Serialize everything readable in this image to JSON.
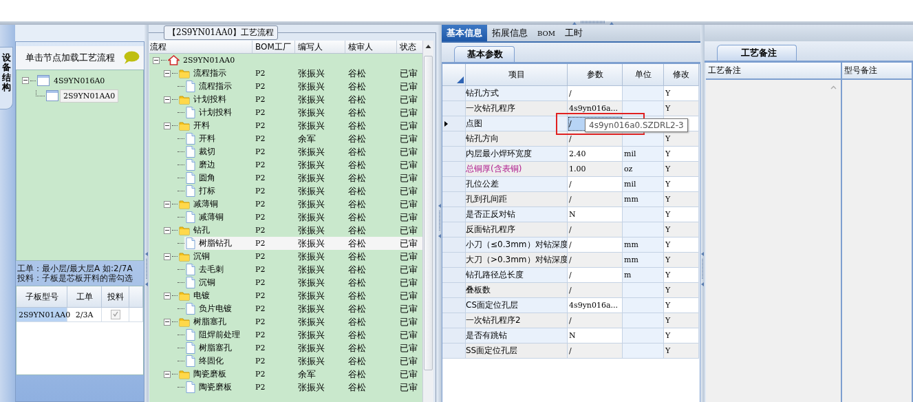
{
  "left_panel": {
    "vertical_tab": "设备结构",
    "hint": "单击节点加载工艺流程",
    "tree": [
      {
        "label": "4S9YN016A0",
        "expanded": true,
        "selected": false,
        "children": [
          {
            "label": "2S9YN01AA0",
            "selected": true
          }
        ]
      }
    ],
    "notes": [
      "工单：最小层/最大层A 如:2/7A",
      "投料：子板是芯板开料的需勾选"
    ],
    "board_table": {
      "columns": [
        "子板型号",
        "工单",
        "投料"
      ],
      "rows": [
        {
          "model": "2S9YN01AA0",
          "work_order": "2/3A",
          "feed": true,
          "selected": true
        }
      ]
    }
  },
  "flow_panel": {
    "title": "【2S9YN01AA0】工艺流程",
    "columns": [
      "流程",
      "BOM工厂",
      "编写人",
      "核审人",
      "状态"
    ],
    "tree": [
      {
        "kind": "root",
        "label": "2S9YN01AA0",
        "expanded": true,
        "selected": false,
        "children": [
          {
            "kind": "folder",
            "label": "流程指示",
            "factory": "P2",
            "writer": "张振兴",
            "reviewer": "谷松",
            "status": "已审",
            "expanded": true,
            "selected": false,
            "children": [
              {
                "kind": "file",
                "label": "流程指示",
                "factory": "P2",
                "writer": "张振兴",
                "reviewer": "谷松",
                "status": "已审",
                "selected": false
              }
            ]
          },
          {
            "kind": "folder",
            "label": "计划投料",
            "factory": "P2",
            "writer": "张振兴",
            "reviewer": "谷松",
            "status": "已审",
            "expanded": true,
            "selected": false,
            "children": [
              {
                "kind": "file",
                "label": "计划投料",
                "factory": "P2",
                "writer": "张振兴",
                "reviewer": "谷松",
                "status": "已审",
                "selected": false
              }
            ]
          },
          {
            "kind": "folder",
            "label": "开料",
            "factory": "P2",
            "writer": "张振兴",
            "reviewer": "谷松",
            "status": "已审",
            "expanded": true,
            "selected": false,
            "children": [
              {
                "kind": "file",
                "label": "开料",
                "factory": "P2",
                "writer": "余军",
                "reviewer": "谷松",
                "status": "已审",
                "selected": false
              },
              {
                "kind": "file",
                "label": "裁切",
                "factory": "P2",
                "writer": "张振兴",
                "reviewer": "谷松",
                "status": "已审",
                "selected": false
              },
              {
                "kind": "file",
                "label": "磨边",
                "factory": "P2",
                "writer": "张振兴",
                "reviewer": "谷松",
                "status": "已审",
                "selected": false
              },
              {
                "kind": "file",
                "label": "圆角",
                "factory": "P2",
                "writer": "张振兴",
                "reviewer": "谷松",
                "status": "已审",
                "selected": false
              },
              {
                "kind": "file",
                "label": "打标",
                "factory": "P2",
                "writer": "张振兴",
                "reviewer": "谷松",
                "status": "已审",
                "selected": false
              }
            ]
          },
          {
            "kind": "folder",
            "label": "减薄铜",
            "factory": "P2",
            "writer": "张振兴",
            "reviewer": "谷松",
            "status": "已审",
            "expanded": true,
            "selected": false,
            "children": [
              {
                "kind": "file",
                "label": "减薄铜",
                "factory": "P2",
                "writer": "张振兴",
                "reviewer": "谷松",
                "status": "已审",
                "selected": false
              }
            ]
          },
          {
            "kind": "folder",
            "label": "钻孔",
            "factory": "P2",
            "writer": "张振兴",
            "reviewer": "谷松",
            "status": "已审",
            "expanded": true,
            "selected": false,
            "children": [
              {
                "kind": "file",
                "label": "树脂钻孔",
                "factory": "P2",
                "writer": "张振兴",
                "reviewer": "谷松",
                "status": "已审",
                "selected": true
              }
            ]
          },
          {
            "kind": "folder",
            "label": "沉铜",
            "factory": "P2",
            "writer": "张振兴",
            "reviewer": "谷松",
            "status": "已审",
            "expanded": true,
            "selected": false,
            "children": [
              {
                "kind": "file",
                "label": "去毛刺",
                "factory": "P2",
                "writer": "张振兴",
                "reviewer": "谷松",
                "status": "已审",
                "selected": false
              },
              {
                "kind": "file",
                "label": "沉铜",
                "factory": "P2",
                "writer": "张振兴",
                "reviewer": "谷松",
                "status": "已审",
                "selected": false
              }
            ]
          },
          {
            "kind": "folder",
            "label": "电镀",
            "factory": "P2",
            "writer": "张振兴",
            "reviewer": "谷松",
            "status": "已审",
            "expanded": true,
            "selected": false,
            "children": [
              {
                "kind": "file",
                "label": "负片电镀",
                "factory": "P2",
                "writer": "张振兴",
                "reviewer": "谷松",
                "status": "已审",
                "selected": false
              }
            ]
          },
          {
            "kind": "folder",
            "label": "树脂塞孔",
            "factory": "P2",
            "writer": "张振兴",
            "reviewer": "谷松",
            "status": "已审",
            "expanded": true,
            "selected": false,
            "children": [
              {
                "kind": "file",
                "label": "阻焊前处理",
                "factory": "P2",
                "writer": "张振兴",
                "reviewer": "谷松",
                "status": "已审",
                "selected": false
              },
              {
                "kind": "file",
                "label": "树脂塞孔",
                "factory": "P2",
                "writer": "张振兴",
                "reviewer": "谷松",
                "status": "已审",
                "selected": false
              },
              {
                "kind": "file",
                "label": "终固化",
                "factory": "P2",
                "writer": "张振兴",
                "reviewer": "谷松",
                "status": "已审",
                "selected": false
              }
            ]
          },
          {
            "kind": "folder",
            "label": "陶瓷磨板",
            "factory": "P2",
            "writer": "余军",
            "reviewer": "谷松",
            "status": "已审",
            "expanded": true,
            "selected": false,
            "children": [
              {
                "kind": "file",
                "label": "陶瓷磨板",
                "factory": "P2",
                "writer": "张振兴",
                "reviewer": "谷松",
                "status": "已审",
                "selected": false
              }
            ]
          }
        ]
      }
    ]
  },
  "info_tabs": [
    {
      "label": "基本信息",
      "selected": true
    },
    {
      "label": "拓展信息",
      "selected": false
    },
    {
      "label": "BOM",
      "selected": false
    },
    {
      "label": "工时",
      "selected": false
    }
  ],
  "param_panel": {
    "tab": "基本参数",
    "columns": [
      "项目",
      "参数",
      "单位",
      "修改"
    ],
    "annotation_frame": true,
    "tooltip": "4s9yn016a0.SZDRL2-3",
    "rows": [
      {
        "item": "钻孔方式",
        "value": "/",
        "modify": "Y",
        "selected": false,
        "flagged": false
      },
      {
        "item": "一次钻孔程序",
        "value": "4s9yn016a...",
        "modify": "Y",
        "selected": false,
        "flagged": false
      },
      {
        "item": "点图",
        "value": "/",
        "selected": true,
        "flagged": false
      },
      {
        "item": "钻孔方向",
        "value": "/",
        "modify": "Y",
        "selected": false,
        "flagged": false
      },
      {
        "item": "内层最小焊环宽度",
        "value": "2.40",
        "unit": "mil",
        "modify": "Y",
        "selected": false,
        "flagged": false
      },
      {
        "item": "总铜厚(含表铜)",
        "value": "1.00",
        "unit": "oz",
        "modify": "Y",
        "selected": false,
        "flagged": true
      },
      {
        "item": "孔位公差",
        "value": "/",
        "unit": "mil",
        "modify": "Y",
        "selected": false,
        "flagged": false
      },
      {
        "item": "孔到孔间距",
        "value": "/",
        "unit": "mm",
        "modify": "Y",
        "selected": false,
        "flagged": false
      },
      {
        "item": "是否正反对钻",
        "value": "N",
        "modify": "Y",
        "selected": false,
        "flagged": false
      },
      {
        "item": "反面钻孔程序",
        "value": "/",
        "modify": "Y",
        "selected": false,
        "flagged": false
      },
      {
        "item": "小刀（≤0.3mm）对钻深度",
        "value": "/",
        "unit": "mm",
        "modify": "Y",
        "selected": false,
        "flagged": false
      },
      {
        "item": "大刀（>0.3mm）对钻深度",
        "value": "/",
        "unit": "mm",
        "modify": "Y",
        "selected": false,
        "flagged": false
      },
      {
        "item": "钻孔路径总长度",
        "value": "/",
        "unit": "m",
        "modify": "Y",
        "selected": false,
        "flagged": false
      },
      {
        "item": "叠板数",
        "value": "/",
        "modify": "Y",
        "selected": false,
        "flagged": false
      },
      {
        "item": "CS面定位孔层",
        "value": "4s9yn016a...",
        "modify": "Y",
        "selected": false,
        "flagged": false
      },
      {
        "item": "一次钻孔程序2",
        "value": "/",
        "modify": "Y",
        "selected": false,
        "flagged": false
      },
      {
        "item": "是否有跳钻",
        "value": "N",
        "modify": "Y",
        "selected": false,
        "flagged": false
      },
      {
        "item": "SS面定位孔层",
        "value": "/",
        "modify": "Y",
        "selected": false,
        "flagged": false
      }
    ]
  },
  "notes_panel": {
    "tab": "工艺备注",
    "columns": [
      "工艺备注",
      "型号备注"
    ]
  }
}
